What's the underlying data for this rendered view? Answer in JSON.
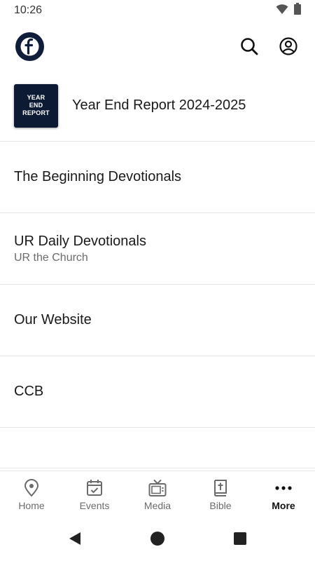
{
  "status_bar": {
    "time": "10:26"
  },
  "header": {
    "logo_letter": "f"
  },
  "list": {
    "featured": {
      "thumb_text": "YEAR\nEND\nREPORT",
      "title": "Year End Report 2024-2025"
    },
    "items": [
      {
        "title": "The Beginning Devotionals",
        "subtitle": ""
      },
      {
        "title": "UR Daily Devotionals",
        "subtitle": "UR the Church"
      },
      {
        "title": "Our Website",
        "subtitle": ""
      },
      {
        "title": "CCB",
        "subtitle": ""
      }
    ]
  },
  "bottom_nav": {
    "items": [
      {
        "label": "Home",
        "icon": "map-pin-icon"
      },
      {
        "label": "Events",
        "icon": "calendar-check-icon"
      },
      {
        "label": "Media",
        "icon": "tv-icon"
      },
      {
        "label": "Bible",
        "icon": "bible-icon"
      },
      {
        "label": "More",
        "icon": "more-dots-icon"
      }
    ],
    "active": "More"
  },
  "colors": {
    "logo_bg": "#0f1d3a",
    "thumb_bg": "#0c1a33",
    "text": "#1a1a1a",
    "muted": "#6b6b6b",
    "divider": "#e6e6e6"
  }
}
